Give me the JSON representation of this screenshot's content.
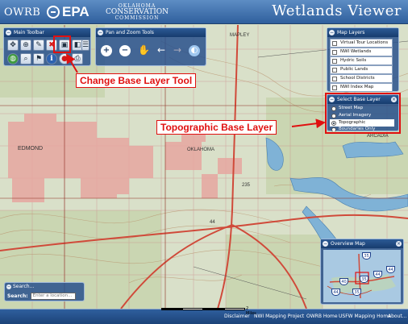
{
  "header": {
    "logo_owrb": "OWRB",
    "logo_epa": "EPA",
    "logo_occ_line1": "OKLAHOMA",
    "logo_occ_line2": "CONSERVATION",
    "logo_occ_line3": "COMMISSION",
    "title": "Wetlands Viewer"
  },
  "main_toolbar": {
    "title": "Main Toolbar",
    "tools": [
      {
        "icon": "pan-arrows-icon",
        "glyph": "✥"
      },
      {
        "icon": "zoom-in-icon",
        "glyph": "⊕"
      },
      {
        "icon": "identify-icon",
        "glyph": "✎"
      },
      {
        "icon": "clear-icon",
        "glyph": "✖"
      },
      {
        "icon": "change-base-layer-icon",
        "glyph": "▣"
      },
      {
        "icon": "layers-icon",
        "glyph": "◧"
      },
      {
        "icon": "list-icon",
        "glyph": "☰"
      },
      {
        "icon": "globe-icon",
        "glyph": "◍"
      },
      {
        "icon": "magnify-icon",
        "glyph": "⌕"
      },
      {
        "icon": "bookmark-icon",
        "glyph": "⚑"
      },
      {
        "icon": "info-icon",
        "glyph": "i"
      },
      {
        "icon": "stop-icon",
        "glyph": "●"
      },
      {
        "icon": "print-icon",
        "glyph": "⎙"
      }
    ]
  },
  "pan_zoom": {
    "title": "Pan and Zoom Tools"
  },
  "map_layers": {
    "title": "Map Layers",
    "items": [
      {
        "label": "Virtual Tour Locations"
      },
      {
        "label": "NWI Wetlands"
      },
      {
        "label": "Hydric Soils"
      },
      {
        "label": "Public Lands"
      },
      {
        "label": "School Districts"
      },
      {
        "label": "NWI Index Map"
      }
    ]
  },
  "base_layer": {
    "title": "Select Base Layer",
    "options": [
      {
        "label": "Street Map",
        "selected": false
      },
      {
        "label": "Aerial Imagery",
        "selected": false
      },
      {
        "label": "Topographic",
        "selected": true
      },
      {
        "label": "Boundaries Only",
        "selected": false
      }
    ]
  },
  "annotations": {
    "change_base_layer": "Change Base Layer Tool",
    "topographic_base_layer": "Topographic Base Layer"
  },
  "map_labels": {
    "town_1": "EDMOND",
    "town_2": "OKLAHOMA",
    "town_3": "ARCADIA",
    "label_4": "MAPLEY",
    "road_1": "235",
    "road_2": "44"
  },
  "search": {
    "title": "Search...",
    "label": "Search:",
    "placeholder": "Enter a location..."
  },
  "overview": {
    "title": "Overview Map",
    "shields": [
      "35",
      "44",
      "40",
      "35",
      "44",
      "44",
      "35"
    ]
  },
  "scale": {
    "label": "2 Miles"
  },
  "footer": {
    "links": [
      "Disclaimer",
      "NWI Mapping Project",
      "OWRB Home",
      "USFW Mapping Home",
      "About..."
    ]
  },
  "colors": {
    "header": "#2f5f9d",
    "annotation": "#e01010",
    "urban": "#e7a7a0",
    "water": "#7fb2d6"
  }
}
